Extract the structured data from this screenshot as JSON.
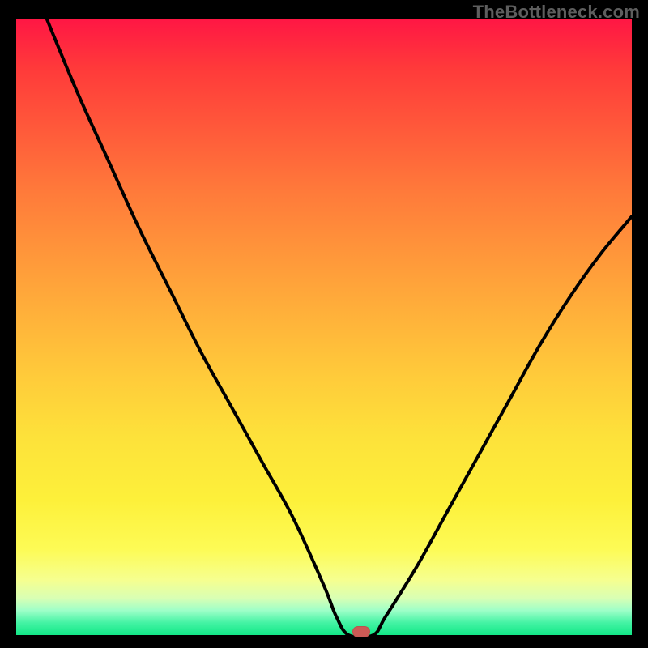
{
  "watermark": "TheBottleneck.com",
  "chart_data": {
    "type": "line",
    "title": "",
    "xlabel": "",
    "ylabel": "",
    "xlim": [
      0,
      100
    ],
    "ylim": [
      0,
      100
    ],
    "grid": false,
    "series": [
      {
        "name": "bottleneck-curve",
        "x": [
          5,
          10,
          15,
          20,
          25,
          30,
          35,
          40,
          45,
          50,
          52,
          54,
          58,
          60,
          65,
          70,
          75,
          80,
          85,
          90,
          95,
          100
        ],
        "y": [
          100,
          88,
          77,
          66,
          56,
          46,
          37,
          28,
          19,
          8,
          3,
          0,
          0,
          3,
          11,
          20,
          29,
          38,
          47,
          55,
          62,
          68
        ]
      }
    ],
    "marker": {
      "x": 56,
      "y": 0.5,
      "label": "optimal-point"
    },
    "color_scale": {
      "type": "vertical-gradient",
      "stops": [
        {
          "pos": 0,
          "color": "#ff1744"
        },
        {
          "pos": 50,
          "color": "#ffc83a"
        },
        {
          "pos": 90,
          "color": "#fdfb55"
        },
        {
          "pos": 100,
          "color": "#12e887"
        }
      ]
    }
  }
}
